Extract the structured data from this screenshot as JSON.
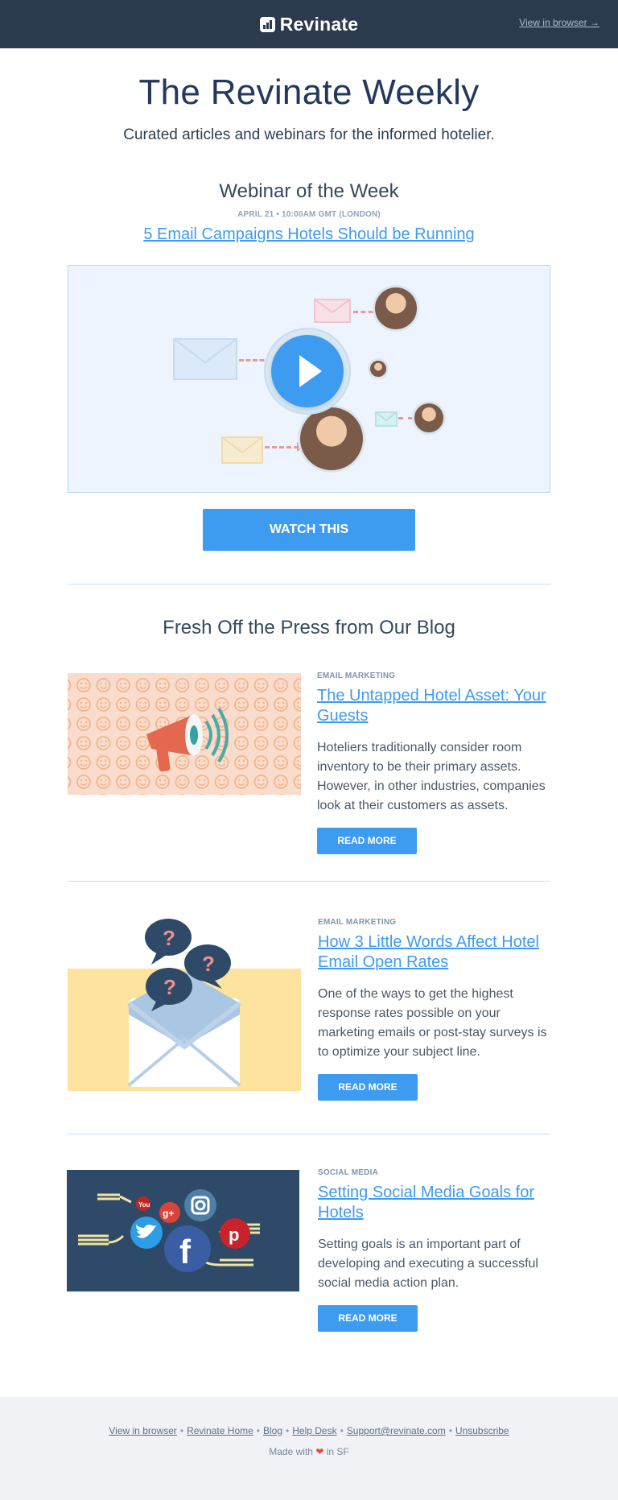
{
  "header": {
    "brand": "Revinate",
    "view_in_browser": "View in browser →"
  },
  "hero": {
    "title": "The Revinate Weekly",
    "subtitle": "Curated articles and webinars for the informed hotelier."
  },
  "webinar": {
    "section_title": "Webinar of the Week",
    "meta": "APRIL 21 •  10:00AM GMT (LONDON)",
    "link_text": "5 Email Campaigns Hotels Should be Running",
    "cta_label": "WATCH THIS"
  },
  "blog": {
    "section_title": "Fresh Off the Press from Our Blog",
    "articles": [
      {
        "category": "EMAIL MARKETING",
        "title": "The Untapped Hotel Asset: Your Guests",
        "text": "Hoteliers traditionally consider room inventory to be their primary assets. However, in other industries, companies look at their customers as assets.",
        "button": "READ MORE",
        "icon": "megaphone-icon"
      },
      {
        "category": "EMAIL MARKETING",
        "title": "How 3 Little Words Affect Hotel Email Open Rates",
        "text": "One of the ways to get the highest response rates possible on your marketing emails or post-stay surveys is to optimize your subject line.",
        "button": "READ MORE",
        "icon": "envelope-icon"
      },
      {
        "category": "SOCIAL MEDIA",
        "title": "Setting Social Media Goals for Hotels",
        "text": "Setting goals is an important part of developing and executing a successful social media action plan.",
        "button": "READ MORE",
        "icon": "social-network-icon"
      }
    ]
  },
  "footer": {
    "links": [
      "View in browser",
      "Revinate Home",
      "Blog",
      "Help Desk",
      "Support@revinate.com",
      "Unsubscribe"
    ],
    "separator": "•",
    "made_prefix": "Made with",
    "made_heart": "❤",
    "made_suffix": "in SF"
  },
  "colors": {
    "header_bg": "#2b3a4c",
    "accent": "#3d9bf0",
    "title": "#23385c",
    "footer_bg": "#f0f2f6"
  }
}
